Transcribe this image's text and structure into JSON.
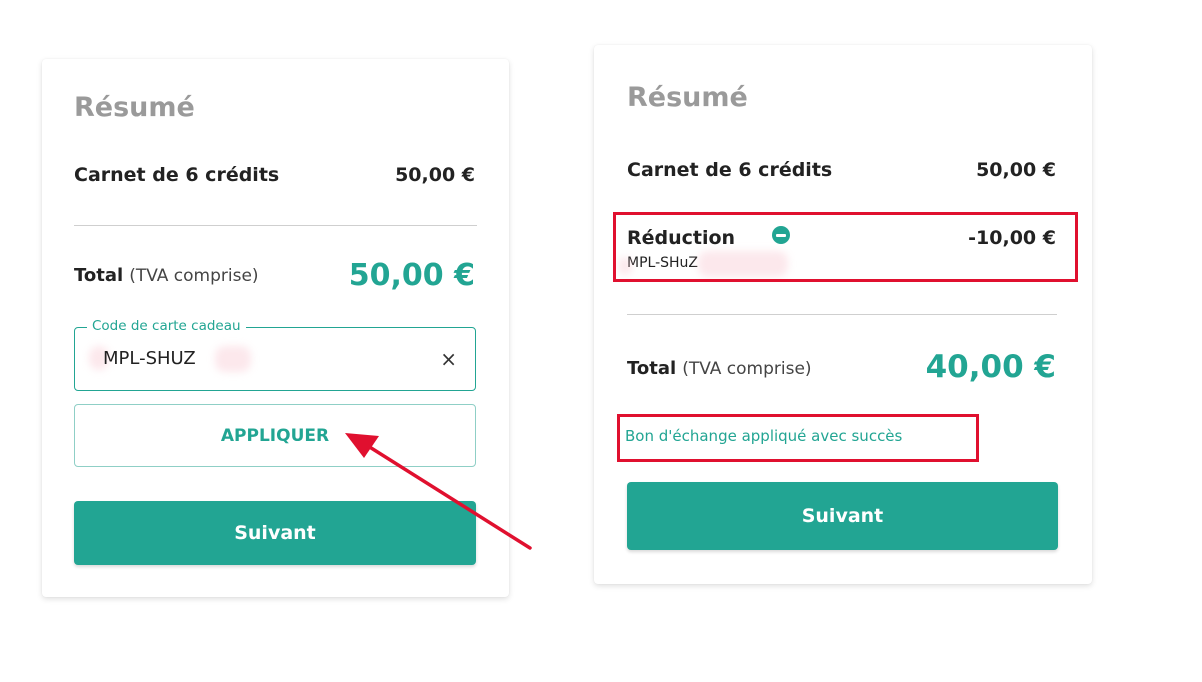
{
  "left_card": {
    "title": "Résumé",
    "item_label": "Carnet de 6 crédits",
    "item_price": "50,00 €",
    "total_label": "Total",
    "total_note": "(TVA comprise)",
    "total_value": "50,00 €",
    "gift_field_label": "Code de carte cadeau",
    "gift_field_value": "MPL-SHUZ",
    "clear_icon": "×",
    "apply_label": "APPLIQUER",
    "next_label": "Suivant"
  },
  "right_card": {
    "title": "Résumé",
    "item_label": "Carnet de 6 crédits",
    "item_price": "50,00 €",
    "discount_label": "Réduction",
    "discount_value": "-10,00 €",
    "discount_code": "MPL-SHuZ",
    "total_label": "Total",
    "total_note": "(TVA comprise)",
    "total_value": "40,00 €",
    "success_message": "Bon d'échange appliqué avec succès",
    "next_label": "Suivant"
  },
  "colors": {
    "accent": "#22a593",
    "annotation": "#e0102f",
    "title_gray": "#9a9a9a"
  }
}
